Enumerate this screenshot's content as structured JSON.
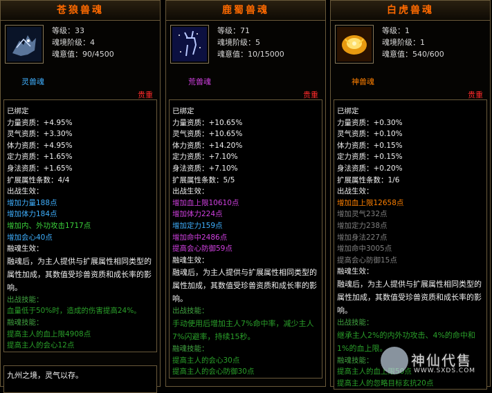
{
  "panels": [
    {
      "title": "苍狼兽魂",
      "level": "等级：33",
      "realm": "魂境阶级：4",
      "will": "魂意值：90/4500",
      "rank": "灵兽魂",
      "rank_color": "#3fb0ff",
      "precious": "贵重",
      "icon": "blue-wolf-soul-icon",
      "lines": [
        {
          "t": "已绑定",
          "c": "c-white"
        },
        {
          "t": "力量资质：+4.95%",
          "c": "c-white"
        },
        {
          "t": "灵气资质：+3.30%",
          "c": "c-white"
        },
        {
          "t": "体力资质：+4.95%",
          "c": "c-white"
        },
        {
          "t": "定力资质：+1.65%",
          "c": "c-white"
        },
        {
          "t": "身法资质：+1.65%",
          "c": "c-white"
        },
        {
          "t": "扩展属性条数：4/4",
          "c": "c-white"
        },
        {
          "t": "出战生效：",
          "c": "c-white"
        },
        {
          "t": "增加力量188点",
          "c": "c-blue"
        },
        {
          "t": "增加体力184点",
          "c": "c-blue"
        },
        {
          "t": "增加内、外功攻击1717点",
          "c": "c-green"
        },
        {
          "t": "增加会心40点",
          "c": "c-blue"
        },
        {
          "t": "融魂生效：",
          "c": "c-white"
        }
      ],
      "fuse_desc": "融魂后，为主人提供与扩展属性相同类型的属性加成，其数值受珍兽资质和成长率的影响。",
      "tail": [
        {
          "t": "出战技能：",
          "c": "c-label"
        },
        {
          "t": "血量低于50%时，造成的伤害提高24%。",
          "c": "c-dkgreen"
        },
        {
          "t": "融魂技能：",
          "c": "c-label"
        },
        {
          "t": "提高主人的血上限4908点",
          "c": "c-dkgreen"
        },
        {
          "t": "提高主人的会心12点",
          "c": "c-dkgreen"
        }
      ],
      "story": "九州之境，灵气以存。"
    },
    {
      "title": "鹿蜀兽魂",
      "level": "等级：71",
      "realm": "魂境阶级：5",
      "will": "魂意值：10/15000",
      "rank": "荒兽魂",
      "rank_color": "#d040e0",
      "precious": "贵重",
      "icon": "star-deer-soul-icon",
      "lines": [
        {
          "t": "已绑定",
          "c": "c-white"
        },
        {
          "t": "力量资质：+10.65%",
          "c": "c-white"
        },
        {
          "t": "灵气资质：+10.65%",
          "c": "c-white"
        },
        {
          "t": "体力资质：+14.20%",
          "c": "c-white"
        },
        {
          "t": "定力资质：+7.10%",
          "c": "c-white"
        },
        {
          "t": "身法资质：+7.10%",
          "c": "c-white"
        },
        {
          "t": "扩展属性条数：5/5",
          "c": "c-white"
        },
        {
          "t": "出战生效：",
          "c": "c-white"
        },
        {
          "t": "增加血上限10610点",
          "c": "c-purple"
        },
        {
          "t": "增加体力224点",
          "c": "c-purple"
        },
        {
          "t": "增加定力159点",
          "c": "c-blue"
        },
        {
          "t": "增加命中2486点",
          "c": "c-purple"
        },
        {
          "t": "提高会心防御59点",
          "c": "c-purple"
        },
        {
          "t": "融魂生效：",
          "c": "c-white"
        }
      ],
      "fuse_desc": "融魂后，为主人提供与扩展属性相同类型的属性加成，其数值受珍兽资质和成长率的影响。",
      "tail": [
        {
          "t": "出战技能：",
          "c": "c-label"
        },
        {
          "t": "手动使用后增加主人7%命中率，减少主人7%闪避率，持续15秒。",
          "c": "c-dkgreen",
          "wrap": true
        },
        {
          "t": "融魂技能：",
          "c": "c-label"
        },
        {
          "t": "提高主人的会心30点",
          "c": "c-dkgreen"
        },
        {
          "t": "提高主人的会心防御30点",
          "c": "c-dkgreen"
        }
      ],
      "story": ""
    },
    {
      "title": "白虎兽魂",
      "level": "等级：1",
      "realm": "魂境阶级：1",
      "will": "魂意值：540/600",
      "rank": "神兽魂",
      "rank_color": "#ff8000",
      "precious": "贵重",
      "icon": "golden-tiger-soul-icon",
      "lines": [
        {
          "t": "已绑定",
          "c": "c-white"
        },
        {
          "t": "力量资质：+0.30%",
          "c": "c-white"
        },
        {
          "t": "灵气资质：+0.10%",
          "c": "c-white"
        },
        {
          "t": "体力资质：+0.15%",
          "c": "c-white"
        },
        {
          "t": "定力资质：+0.15%",
          "c": "c-white"
        },
        {
          "t": "身法资质：+0.20%",
          "c": "c-white"
        },
        {
          "t": "扩展属性条数：1/6",
          "c": "c-white"
        },
        {
          "t": "出战生效：",
          "c": "c-white"
        },
        {
          "t": "增加血上限12658点",
          "c": "c-orange"
        },
        {
          "t": "增加灵气232点",
          "c": "c-gray"
        },
        {
          "t": "增加定力238点",
          "c": "c-gray"
        },
        {
          "t": "增加身法227点",
          "c": "c-gray"
        },
        {
          "t": "增加命中3005点",
          "c": "c-gray"
        },
        {
          "t": "提高会心防御15点",
          "c": "c-gray"
        },
        {
          "t": "融魂生效：",
          "c": "c-white"
        }
      ],
      "fuse_desc": "融魂后，为主人提供与扩展属性相同类型的属性加成，其数值受珍兽资质和成长率的影响。",
      "tail": [
        {
          "t": "出战技能：",
          "c": "c-label"
        },
        {
          "t": "继承主人2%的内外功攻击、4%的命中和1%的血上限。",
          "c": "c-dkgreen",
          "wrap": true
        },
        {
          "t": "融魂技能：",
          "c": "c-label"
        },
        {
          "t": "提高主人的血上限50点",
          "c": "c-dkgreen"
        },
        {
          "t": "提高主人的忽略目标玄抗20点",
          "c": "c-dkgreen"
        }
      ],
      "story": ""
    }
  ],
  "watermark": {
    "text": "神仙代售",
    "url": "WWW.SXDS.COM"
  }
}
